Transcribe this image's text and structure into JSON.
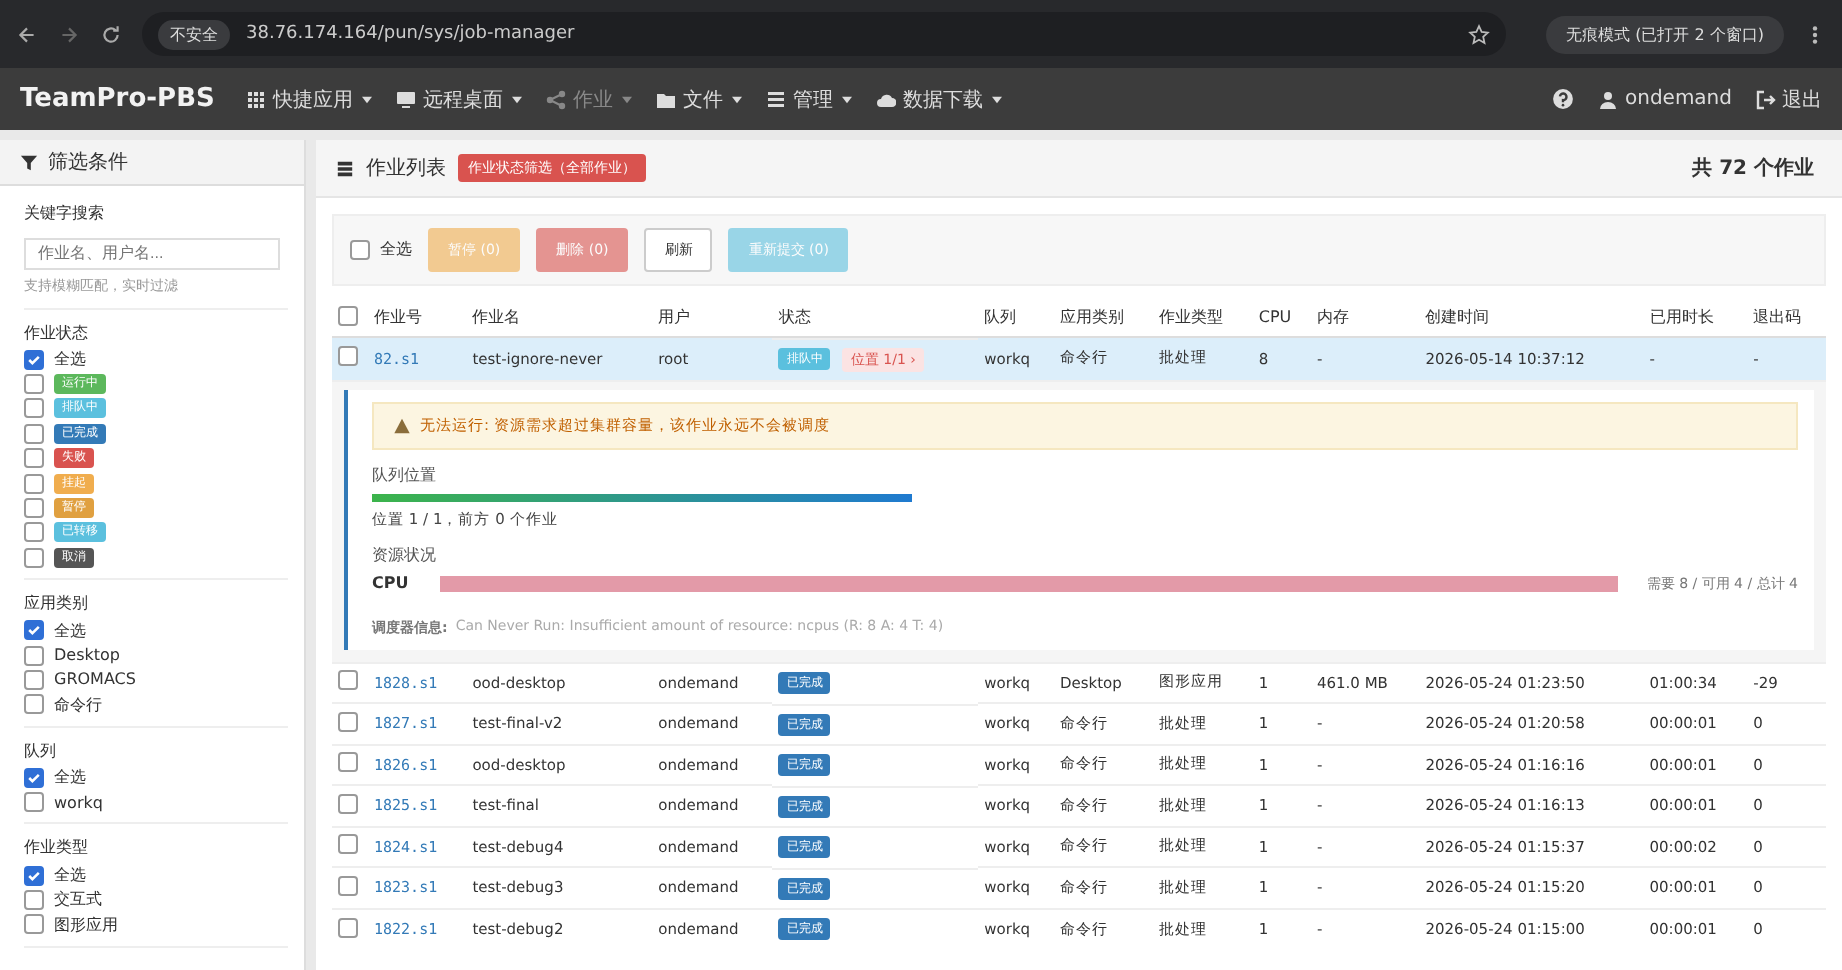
{
  "browser": {
    "security": "不安全",
    "url": "38.76.174.164/pun/sys/job-manager",
    "incognito": "无痕模式 (已打开 2 个窗口)"
  },
  "navbar": {
    "brand": "TeamPro-PBS",
    "menus": [
      {
        "label": "快捷应用",
        "active": false
      },
      {
        "label": "远程桌面",
        "active": false
      },
      {
        "label": "作业",
        "active": true
      },
      {
        "label": "文件",
        "active": false
      },
      {
        "label": "管理",
        "active": false
      },
      {
        "label": "数据下载",
        "active": false
      }
    ],
    "user": "ondemand",
    "logout": "退出"
  },
  "sidebar": {
    "title": "筛选条件",
    "keyword_label": "关键字搜索",
    "search": {
      "placeholder": "作业名、用户名..."
    },
    "hint": "支持模糊匹配，实时过滤",
    "groups": [
      {
        "title": "作业状态",
        "options": [
          {
            "label": "全选",
            "checked": true,
            "kind": "text"
          },
          {
            "label": "运行中",
            "checked": false,
            "kind": "badge",
            "color": "#5cb85c"
          },
          {
            "label": "排队中",
            "checked": false,
            "kind": "badge",
            "color": "#5bc0de"
          },
          {
            "label": "已完成",
            "checked": false,
            "kind": "badge",
            "color": "#337ab7"
          },
          {
            "label": "失败",
            "checked": false,
            "kind": "badge",
            "color": "#d9534f"
          },
          {
            "label": "挂起",
            "checked": false,
            "kind": "badge",
            "color": "#f0ad4e"
          },
          {
            "label": "暂停",
            "checked": false,
            "kind": "badge",
            "color": "#e0a040"
          },
          {
            "label": "已转移",
            "checked": false,
            "kind": "badge",
            "color": "#5bc0de"
          },
          {
            "label": "取消",
            "checked": false,
            "kind": "badge",
            "color": "#555555"
          }
        ]
      },
      {
        "title": "应用类别",
        "options": [
          {
            "label": "全选",
            "checked": true,
            "kind": "text"
          },
          {
            "label": "Desktop",
            "checked": false,
            "kind": "text"
          },
          {
            "label": "GROMACS",
            "checked": false,
            "kind": "text"
          },
          {
            "label": "命令行",
            "checked": false,
            "kind": "text"
          }
        ]
      },
      {
        "title": "队列",
        "options": [
          {
            "label": "全选",
            "checked": true,
            "kind": "text"
          },
          {
            "label": "workq",
            "checked": false,
            "kind": "text"
          }
        ]
      },
      {
        "title": "作业类型",
        "options": [
          {
            "label": "全选",
            "checked": true,
            "kind": "text"
          },
          {
            "label": "交互式",
            "checked": false,
            "kind": "text"
          },
          {
            "label": "图形应用",
            "checked": false,
            "kind": "text"
          }
        ]
      }
    ]
  },
  "main": {
    "title": "作业列表",
    "filter_badge": "作业状态筛选（全部作业）",
    "total": "共 72 个作业",
    "toolbar": {
      "select_all": {
        "label": "全选",
        "checked": false
      },
      "buttons": [
        {
          "label": "暂停 (0)",
          "kind": "warning",
          "disabled": true
        },
        {
          "label": "删除 (0)",
          "kind": "danger",
          "disabled": true
        },
        {
          "label": "刷新",
          "kind": "default",
          "disabled": false
        },
        {
          "label": "重新提交 (0)",
          "kind": "info",
          "disabled": true
        }
      ]
    },
    "header_checkbox": {
      "checked": false
    },
    "columns": [
      "作业号",
      "作业名",
      "用户",
      "状态",
      "队列",
      "应用类别",
      "作业类型",
      "CPU",
      "内存",
      "创建时间",
      "已用时长",
      "退出码"
    ],
    "rows": [
      {
        "checked": false,
        "expanded": true,
        "id": "82.s1",
        "name": "test-ignore-never",
        "user": "root",
        "status": {
          "label": "排队中",
          "color": "#5bc0de"
        },
        "position": "位置 1/1 ›",
        "queue": "workq",
        "app": "命令行",
        "type": "批处理",
        "cpu": "8",
        "mem": "-",
        "created": "2026-05-14 10:37:12",
        "elapsed": "-",
        "exit": "-",
        "detail": {
          "warning": "无法运行: 资源需求超过集群容量，该作业永远不会被调度",
          "queue_label": "队列位置",
          "queue_bar": {
            "level": 1
          },
          "queue_text": "位置 1 / 1，前方 0 个作业",
          "resource_label": "资源状况",
          "resources": [
            {
              "name": "CPU",
              "level": 1,
              "reading": "需要 8 / 可用 4 / 总计 4"
            }
          ],
          "scheduler_label": "调度器信息:",
          "scheduler_text": "Can Never Run: Insufficient amount of resource: ncpus (R: 8 A: 4 T: 4)"
        }
      },
      {
        "checked": false,
        "expanded": false,
        "id": "1828.s1",
        "name": "ood-desktop",
        "user": "ondemand",
        "status": {
          "label": "已完成",
          "color": "#337ab7"
        },
        "queue": "workq",
        "app": "Desktop",
        "type": "图形应用",
        "cpu": "1",
        "mem": "461.0 MB",
        "created": "2026-05-24 01:23:50",
        "elapsed": "01:00:34",
        "exit": "-29"
      },
      {
        "checked": false,
        "expanded": false,
        "id": "1827.s1",
        "name": "test-final-v2",
        "user": "ondemand",
        "status": {
          "label": "已完成",
          "color": "#337ab7"
        },
        "queue": "workq",
        "app": "命令行",
        "type": "批处理",
        "cpu": "1",
        "mem": "-",
        "created": "2026-05-24 01:20:58",
        "elapsed": "00:00:01",
        "exit": "0"
      },
      {
        "checked": false,
        "expanded": false,
        "id": "1826.s1",
        "name": "ood-desktop",
        "user": "ondemand",
        "status": {
          "label": "已完成",
          "color": "#337ab7"
        },
        "queue": "workq",
        "app": "命令行",
        "type": "批处理",
        "cpu": "1",
        "mem": "-",
        "created": "2026-05-24 01:16:16",
        "elapsed": "00:00:01",
        "exit": "0"
      },
      {
        "checked": false,
        "expanded": false,
        "id": "1825.s1",
        "name": "test-final",
        "user": "ondemand",
        "status": {
          "label": "已完成",
          "color": "#337ab7"
        },
        "queue": "workq",
        "app": "命令行",
        "type": "批处理",
        "cpu": "1",
        "mem": "-",
        "created": "2026-05-24 01:16:13",
        "elapsed": "00:00:01",
        "exit": "0"
      },
      {
        "checked": false,
        "expanded": false,
        "id": "1824.s1",
        "name": "test-debug4",
        "user": "ondemand",
        "status": {
          "label": "已完成",
          "color": "#337ab7"
        },
        "queue": "workq",
        "app": "命令行",
        "type": "批处理",
        "cpu": "1",
        "mem": "-",
        "created": "2026-05-24 01:15:37",
        "elapsed": "00:00:02",
        "exit": "0"
      },
      {
        "checked": false,
        "expanded": false,
        "id": "1823.s1",
        "name": "test-debug3",
        "user": "ondemand",
        "status": {
          "label": "已完成",
          "color": "#337ab7"
        },
        "queue": "workq",
        "app": "命令行",
        "type": "批处理",
        "cpu": "1",
        "mem": "-",
        "created": "2026-05-24 01:15:20",
        "elapsed": "00:00:01",
        "exit": "0"
      },
      {
        "checked": false,
        "expanded": false,
        "id": "1822.s1",
        "name": "test-debug2",
        "user": "ondemand",
        "status": {
          "label": "已完成",
          "color": "#337ab7"
        },
        "queue": "workq",
        "app": "命令行",
        "type": "批处理",
        "cpu": "1",
        "mem": "-",
        "created": "2026-05-24 01:15:00",
        "elapsed": "00:00:01",
        "exit": "0"
      }
    ]
  }
}
